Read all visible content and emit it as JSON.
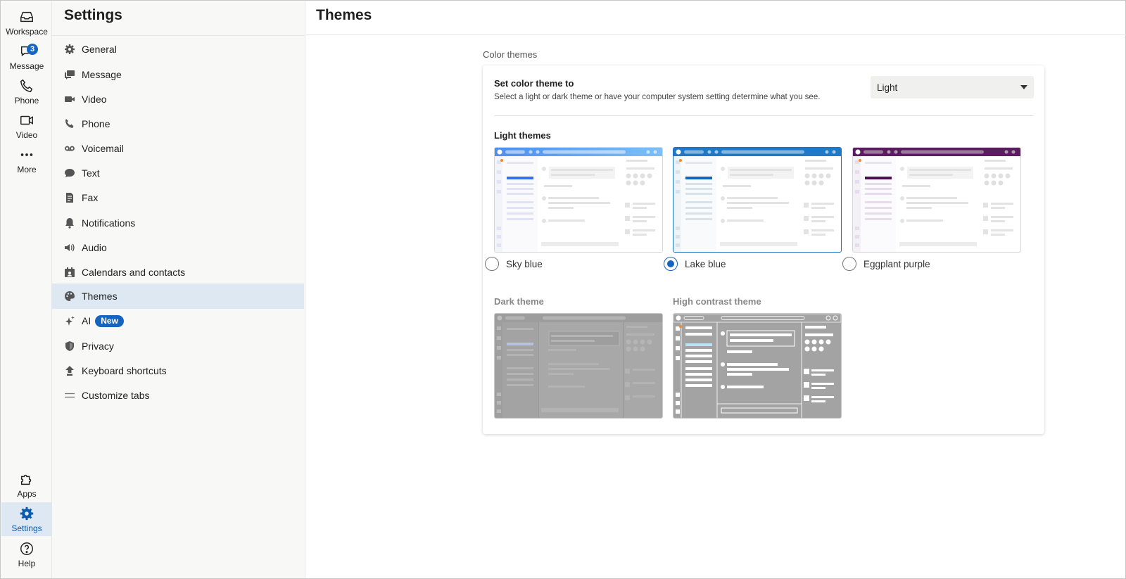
{
  "rail": {
    "items": [
      {
        "label": "Workspace",
        "icon": "workspace-icon"
      },
      {
        "label": "Message",
        "icon": "message-icon",
        "badge": "3"
      },
      {
        "label": "Phone",
        "icon": "phone-icon"
      },
      {
        "label": "Video",
        "icon": "video-icon"
      },
      {
        "label": "More",
        "icon": "more-icon"
      }
    ],
    "bottom": [
      {
        "label": "Apps",
        "icon": "apps-icon"
      },
      {
        "label": "Settings",
        "icon": "settings-icon",
        "active": true
      },
      {
        "label": "Help",
        "icon": "help-icon"
      }
    ]
  },
  "nav": {
    "title": "Settings",
    "items": [
      {
        "label": "General",
        "icon": "gear-icon"
      },
      {
        "label": "Message",
        "icon": "chat-icon"
      },
      {
        "label": "Video",
        "icon": "video-icon"
      },
      {
        "label": "Phone",
        "icon": "phone-icon"
      },
      {
        "label": "Voicemail",
        "icon": "voicemail-icon"
      },
      {
        "label": "Text",
        "icon": "text-bubble-icon"
      },
      {
        "label": "Fax",
        "icon": "fax-icon"
      },
      {
        "label": "Notifications",
        "icon": "bell-icon"
      },
      {
        "label": "Audio",
        "icon": "speaker-icon"
      },
      {
        "label": "Calendars and contacts",
        "icon": "calendar-icon"
      },
      {
        "label": "Themes",
        "icon": "palette-icon",
        "active": true
      },
      {
        "label": "AI",
        "icon": "sparkle-icon",
        "pill": "New"
      },
      {
        "label": "Privacy",
        "icon": "shield-icon"
      },
      {
        "label": "Keyboard shortcuts",
        "icon": "keyboard-shortcut-icon"
      },
      {
        "label": "Customize tabs",
        "icon": "menu-lines-icon"
      }
    ]
  },
  "main": {
    "title": "Themes",
    "section_label": "Color themes",
    "set_title": "Set color theme to",
    "set_desc": "Select a light or dark theme or have your computer system setting determine what you see.",
    "select_value": "Light",
    "light_label": "Light themes",
    "light_themes": [
      {
        "name": "Sky blue",
        "accent": "#5aa0f5",
        "accent2": "#3b7ee8",
        "checked": false
      },
      {
        "name": "Lake blue",
        "accent": "#1f78c8",
        "accent2": "#1565c0",
        "checked": true
      },
      {
        "name": "Eggplant purple",
        "accent": "#6a2a6e",
        "accent2": "#4a1050",
        "checked": false
      }
    ],
    "dark_label": "Dark theme",
    "contrast_label": "High contrast theme"
  },
  "colors": {
    "brand": "#1565c0",
    "active_bg": "#dde8f2",
    "disabled_thumb": "#a8a8a8"
  }
}
